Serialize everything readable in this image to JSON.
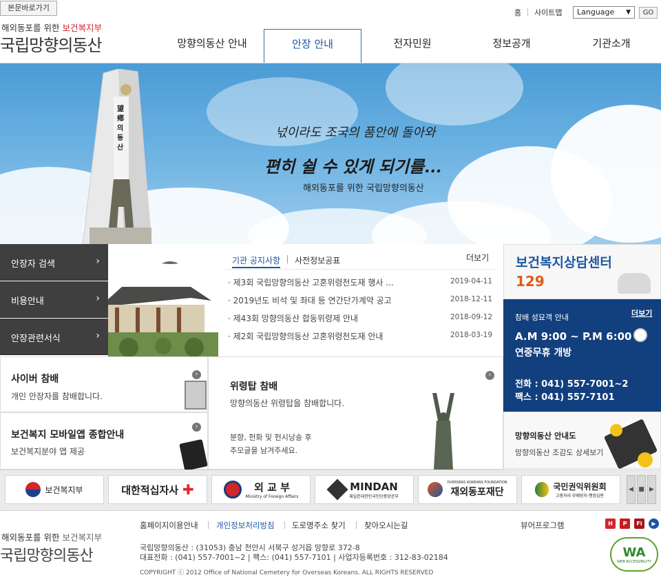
{
  "header": {
    "skip_link": "본문바로가기",
    "logo_sub_prefix": "해외동포를 위한 ",
    "logo_sub_highlight": "보건복지부",
    "logo_main": "국립망향의동산",
    "util_home": "홈",
    "util_sitemap": "사이트맵",
    "language_select": "Language",
    "go_button": "GO"
  },
  "gnb": {
    "items": [
      "망향의동산 안내",
      "안장 안내",
      "전자민원",
      "정보공개",
      "기관소개"
    ],
    "active_index": 1
  },
  "banner": {
    "line1": "넋이라도 조국의 품안에 돌아와",
    "line2": "편히 쉴 수 있게 되기를...",
    "line3": "해외동포를 위한 국립망향의동산",
    "monument_text": "望鄕의동산"
  },
  "left_menu": [
    "안장자 검색",
    "비용안내",
    "안장관련서식"
  ],
  "notice": {
    "tab_active": "기관 공지사항",
    "tab_inactive": "사전정보공표",
    "more": "더보기",
    "items": [
      {
        "title": "제3회 국립망향의동산 고혼위령천도재 행사 ...",
        "date": "2019-04-11"
      },
      {
        "title": "2019년도 비석 및 좌대 등 연간단가계약 공고",
        "date": "2018-12-11"
      },
      {
        "title": "제43회 망향의동산 합동위령제 안내",
        "date": "2018-09-12"
      },
      {
        "title": "제2회 국립망향의동산 고혼위령천도재 안내",
        "date": "2018-03-19"
      }
    ]
  },
  "counsel": {
    "title": "보건복지상담센터",
    "number": "129"
  },
  "hours": {
    "label": "참배 성묘객 안내",
    "more": "더보기",
    "time": "A.M 9:00 ~ P.M 6:00",
    "open": "연중무휴 개방",
    "phone": "전화 : 041) 557-7001~2",
    "fax": "팩스 : 041) 557-7101"
  },
  "intro": {
    "title": "망향의동산 안내도",
    "desc": "망향의동산 조감도 상세보기"
  },
  "cards": {
    "cyber": {
      "title": "사이버 참배",
      "desc": "개인 안장자를 참배합니다."
    },
    "mobile": {
      "title": "보건복지 모바일앱 종합안내",
      "desc": "보건복지분야 앱 제공"
    },
    "tower": {
      "title": "위령탑 참배",
      "desc": "망향의동산 위령탑을 참배합니다.",
      "note1": "분향, 헌화 및 헌시낭송 후",
      "note2": "추모글을 남겨주세요."
    }
  },
  "partners": [
    {
      "name": "보건복지부",
      "color": "#1d3f8f"
    },
    {
      "name": "대한적십자사",
      "color": "#e3262b"
    },
    {
      "name": "외 교 부",
      "color": "#1c3b7a",
      "sub": "Ministry of Foreign Affairs"
    },
    {
      "name": "MINDAN",
      "color": "#222222",
      "sub": "재일본대한민국민단중앙본부"
    },
    {
      "name": "재외동포재단",
      "color": "#1c56a3",
      "sub": "OVERSEAS KOREANS FOUNDATION"
    },
    {
      "name": "국민권익위원회",
      "color": "#2f7c3a",
      "sub": "고충처리·부패방지·행정심판"
    }
  ],
  "footer": {
    "logo_sub_prefix": "해외동포를 위한 ",
    "logo_sub_highlight": "보건복지부",
    "logo_main": "국립망향의동산",
    "links": [
      "홈페이지이용안내",
      "개인정보처리방침",
      "도로명주소 찾기",
      "찾아오시는길"
    ],
    "viewer": "뷰어프로그램",
    "address": "국립망향의동산 : (31053) 충남 천안시 서북구 성거읍 망향로 372-8",
    "contact": "대표전화 : (041) 557-7001~2 | 팩스: (041) 557-7101 | 사업자등록번호 : 312-83-02184",
    "copyright": "COPYRIGHT ⓒ 2012 Office of National Cemetery for Overseas Koreans. ALL RIGHTS RESERVED",
    "wa_mark": "WA",
    "wa_text": "WEB ACCESSIBILITY"
  }
}
